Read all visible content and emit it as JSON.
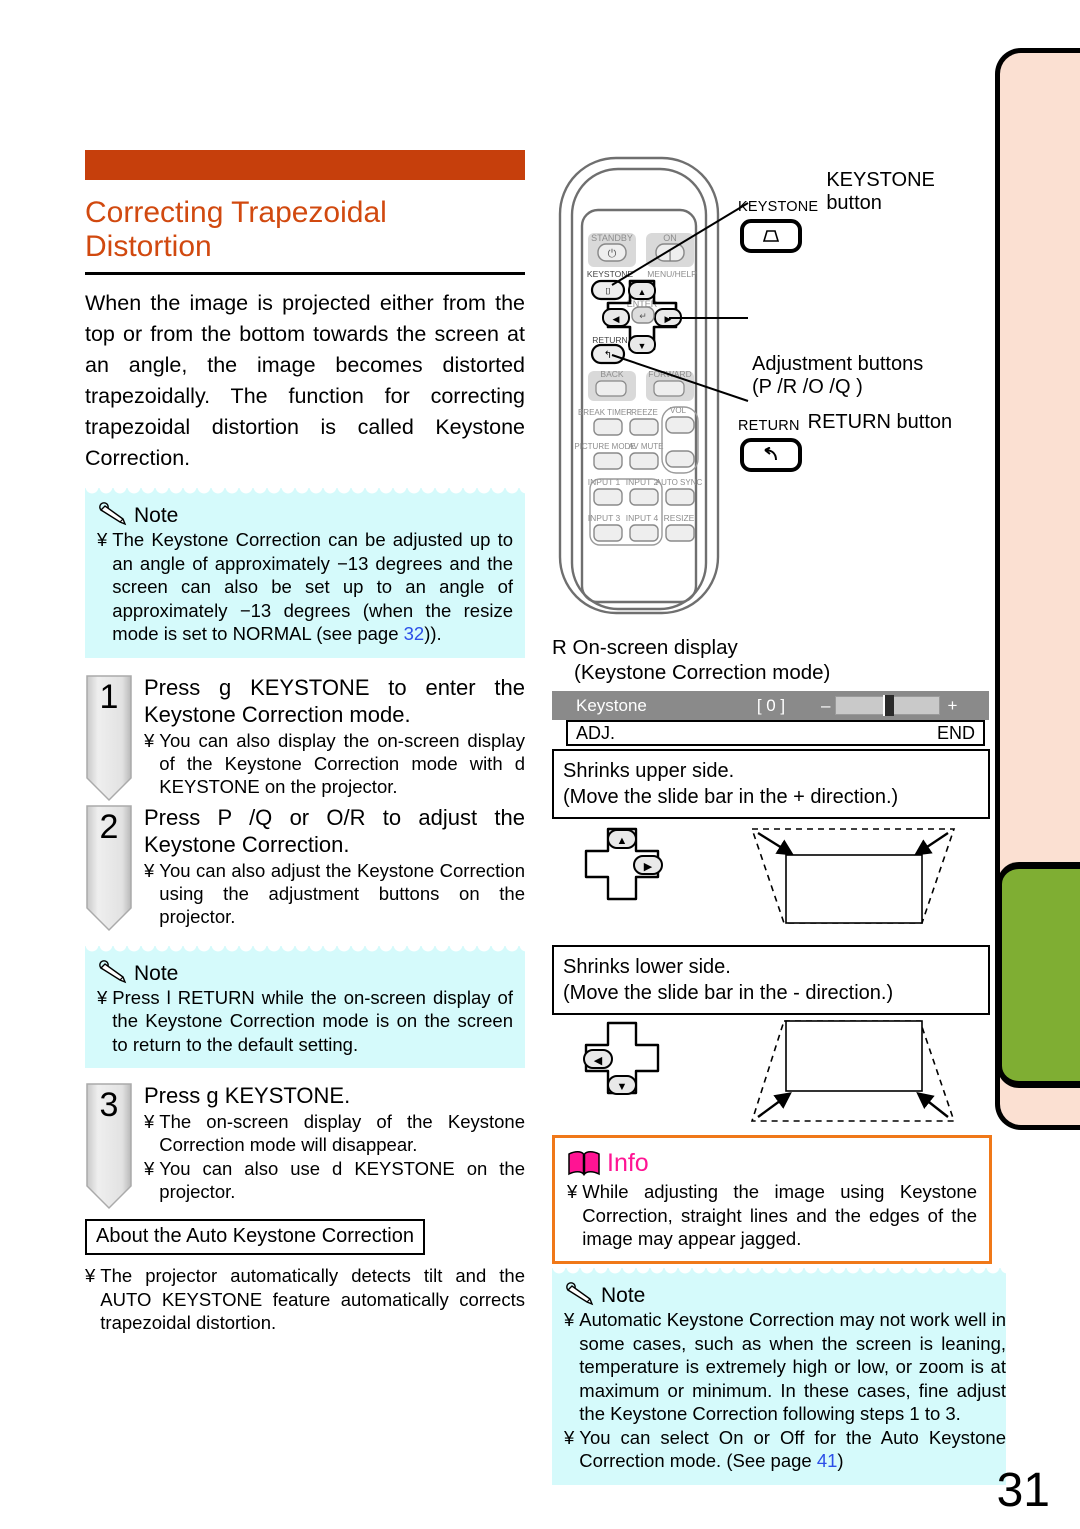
{
  "page": {
    "number": "31",
    "accent_title": "#D1490F",
    "accent_bar": "#C63F0C",
    "note_bg": "#D5FAFB",
    "info_border": "#F07818",
    "info_pink": "#FF1493",
    "tab_peach": "#FBE0D2",
    "tab_green": "#7FAE33"
  },
  "left": {
    "title_line1": "Correcting Trapezoidal",
    "title_line2": "Distortion",
    "intro": "When the image is projected either from the top or from the bottom towards the screen at an angle, the image becomes distorted trapezoidally. The function for correcting trapezoidal distortion is called Keystone Correction.",
    "note1": {
      "label": "Note",
      "bullet": "¥",
      "text_before": "The Keystone Correction can be adjusted up to an angle of approximately −13 degrees and the screen can also be set up to an angle of approximately −13 degrees (when the resize mode is set to  NORMAL  (see page ",
      "page_ref": "32",
      "text_after": "))."
    },
    "steps": [
      {
        "number": "1",
        "head": "Press  g    KEYSTONE to enter the Keystone Correction mode.",
        "subs": [
          "You can also display the on-screen display of the Keystone Correction mode with d   KEYSTONE on the projector."
        ]
      },
      {
        "number": "2",
        "head": "Press  P /Q  or  O/R  to adjust the Keystone Correction.",
        "subs": [
          "You can also adjust the Keystone Correction using the adjustment buttons on the projector."
        ]
      },
      {
        "number": "3",
        "head": "Press  g   KEYSTONE.",
        "subs": [
          "The on-screen display of the Keystone Correction mode will disappear.",
          "You can also use d   KEYSTONE on the projector."
        ]
      }
    ],
    "note2": {
      "label": "Note",
      "bullet": "¥",
      "text": "Press l     RETURN while the on-screen display of the Keystone Correction mode is on the screen to return to the default setting."
    },
    "about": {
      "heading": "About the Auto Keystone Correction",
      "bullet": "¥",
      "body": "The projector automatically detects tilt and the AUTO KEYSTONE feature automatically corrects trapezoidal distortion."
    }
  },
  "right": {
    "remote": {
      "buttons": [
        {
          "label": "STANDBY"
        },
        {
          "label": "ON"
        },
        {
          "label": "KEYSTONE"
        },
        {
          "label": "MENU/HELP"
        },
        {
          "label": "ENTER"
        },
        {
          "label": "RETURN"
        },
        {
          "label": "BACK"
        },
        {
          "label": "FORWARD"
        },
        {
          "label": "BREAK TIMER"
        },
        {
          "label": "FREEZE"
        },
        {
          "label": "VOL"
        },
        {
          "label": "PICTURE MODE"
        },
        {
          "label": "AV MUTE"
        },
        {
          "label": "INPUT 1"
        },
        {
          "label": "INPUT 2"
        },
        {
          "label": "AUTO SYNC"
        },
        {
          "label": "INPUT 3"
        },
        {
          "label": "INPUT 4"
        },
        {
          "label": "RESIZE"
        }
      ]
    },
    "callouts": {
      "keystone_small": "KEYSTONE",
      "keystone_text": "KEYSTONE button",
      "adjust_line1": "Adjustment buttons",
      "adjust_line2": "(P /R /O /Q )",
      "return_small": "RETURN",
      "return_text": "RETURN button"
    },
    "osd": {
      "marker": "R",
      "head_line1": "On-screen display",
      "head_line2": "(Keystone Correction mode)",
      "bar_label": "Keystone",
      "bar_value": "[      0 ]",
      "minus": "–",
      "plus": "+",
      "adj_left": "ADJ.",
      "adj_right": "END"
    },
    "caption_upper_line1": "Shrinks upper side.",
    "caption_upper_line2": "(Move the slide bar in the + direction.)",
    "caption_lower_line1": "Shrinks lower side.",
    "caption_lower_line2": "(Move the slide bar in the - direction.)",
    "info": {
      "label": "Info",
      "bullet": "¥",
      "text": "While adjusting the image using Keystone Correction, straight lines and the edges of the image may appear jagged."
    },
    "note3": {
      "label": "Note",
      "bullet": "¥",
      "line1": "Automatic Keystone Correction may not work well in some cases, such as when the screen is leaning, temperature is extremely high or low, or zoom is at maximum or minimum. In these cases, fine adjust the Keystone Correction following steps 1 to 3.",
      "line2_before": "You can select  On  or  Off  for the Auto Keystone Correction mode. (See page ",
      "line2_page": "41",
      "line2_after": ")"
    }
  }
}
